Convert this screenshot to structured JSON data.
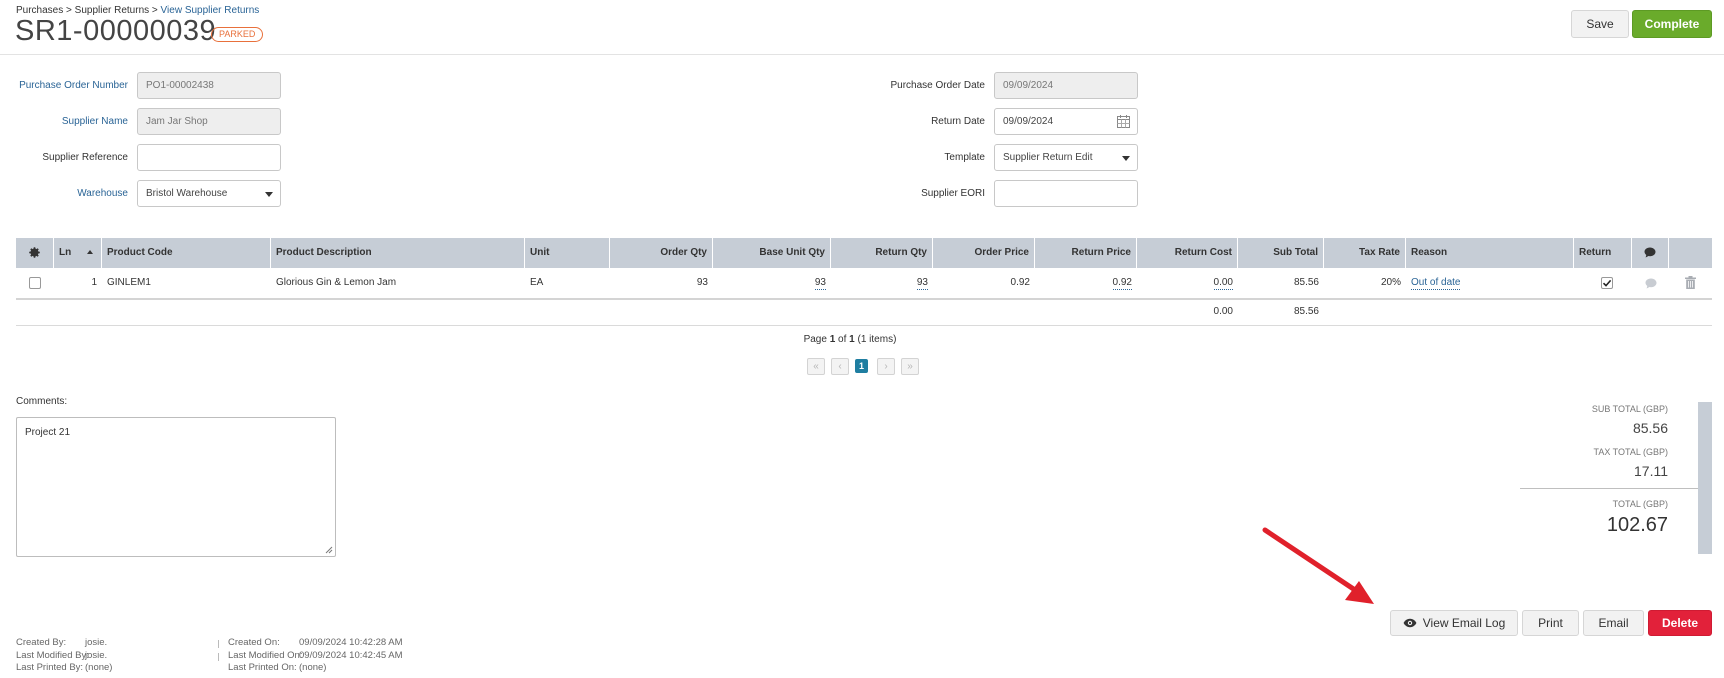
{
  "breadcrumb": {
    "item1": "Purchases",
    "sep": ">",
    "item2": "Supplier Returns",
    "item3": "View Supplier Returns"
  },
  "page": {
    "title": "SR1-00000039",
    "status": "PARKED"
  },
  "actions": {
    "save": "Save",
    "complete": "Complete",
    "view_email_log": "View Email Log",
    "print": "Print",
    "email": "Email",
    "delete": "Delete"
  },
  "form": {
    "po_number": {
      "label": "Purchase Order Number",
      "value": "PO1-00002438"
    },
    "supplier_name": {
      "label": "Supplier Name",
      "value": "Jam Jar Shop"
    },
    "supplier_reference": {
      "label": "Supplier Reference",
      "value": ""
    },
    "warehouse": {
      "label": "Warehouse",
      "value": "Bristol Warehouse"
    },
    "po_date": {
      "label": "Purchase Order Date",
      "value": "09/09/2024"
    },
    "return_date": {
      "label": "Return Date",
      "value": "09/09/2024"
    },
    "template": {
      "label": "Template",
      "value": "Supplier Return Edit"
    },
    "supplier_eori": {
      "label": "Supplier EORI",
      "value": ""
    }
  },
  "table": {
    "headers": {
      "ln": "Ln",
      "product_code": "Product Code",
      "product_description": "Product Description",
      "unit": "Unit",
      "order_qty": "Order Qty",
      "base_unit_qty": "Base Unit Qty",
      "return_qty": "Return Qty",
      "order_price": "Order Price",
      "return_price": "Return Price",
      "return_cost": "Return Cost",
      "sub_total": "Sub Total",
      "tax_rate": "Tax Rate",
      "reason": "Reason",
      "return": "Return"
    },
    "rows": [
      {
        "ln": "1",
        "product_code": "GINLEM1",
        "product_description": "Glorious Gin & Lemon Jam",
        "unit": "EA",
        "order_qty": "93",
        "base_unit_qty": "93",
        "return_qty": "93",
        "order_price": "0.92",
        "return_price": "0.92",
        "return_cost": "0.00",
        "sub_total": "85.56",
        "tax_rate": "20%",
        "reason": "Out of date",
        "return_checked": true
      }
    ],
    "footer": {
      "return_cost": "0.00",
      "sub_total": "85.56"
    }
  },
  "pager": {
    "text_prefix": "Page",
    "current": "1",
    "text_of": "of",
    "total": "1",
    "items_text": "(1 items)"
  },
  "comments": {
    "label": "Comments:",
    "value": "Project 21"
  },
  "totals": {
    "sub_total_label": "SUB TOTAL (GBP)",
    "sub_total": "85.56",
    "tax_total_label": "TAX TOTAL (GBP)",
    "tax_total": "17.11",
    "total_label": "TOTAL (GBP)",
    "total": "102.67"
  },
  "audit": {
    "created_by_label": "Created By:",
    "created_by": "josie.",
    "last_modified_by_label": "Last Modified By:",
    "last_modified_by": "josie.",
    "last_printed_by_label": "Last Printed By:",
    "last_printed_by": "(none)",
    "created_on_label": "Created On:",
    "created_on": "09/09/2024 10:42:28 AM",
    "last_modified_on_label": "Last Modified On:",
    "last_modified_on": "09/09/2024 10:42:45 AM",
    "last_printed_on_label": "Last Printed On:",
    "last_printed_on": "(none)"
  },
  "colors": {
    "accent_blue": "#2a6496",
    "complete_green": "#6aab2b",
    "delete_red": "#e2213a",
    "parked_orange": "#e8703b",
    "grid_header": "#c6cdd6",
    "annotation_arrow": "#e0212b"
  }
}
